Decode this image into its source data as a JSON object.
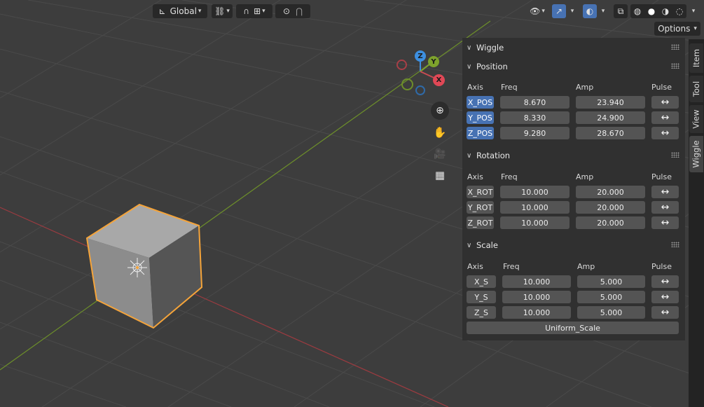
{
  "header": {
    "transform_orientation": "Global",
    "options_label": "Options"
  },
  "gizmo": {
    "x_label": "X",
    "y_label": "Y",
    "z_label": "Z"
  },
  "navigation_icons": [
    "zoom-icon",
    "hand-icon",
    "camera-icon",
    "grid-icon"
  ],
  "tabs": [
    "Item",
    "Tool",
    "View",
    "Wiggle"
  ],
  "active_tab": "Wiggle",
  "panel": {
    "title": "Wiggle",
    "position": {
      "title": "Position",
      "headers": {
        "axis": "Axis",
        "freq": "Freq",
        "amp": "Amp",
        "pulse": "Pulse"
      },
      "rows": [
        {
          "axis": "X_POS",
          "freq": "8.670",
          "amp": "23.940",
          "pulse": "↔"
        },
        {
          "axis": "Y_POS",
          "freq": "8.330",
          "amp": "24.900",
          "pulse": "↔"
        },
        {
          "axis": "Z_POS",
          "freq": "9.280",
          "amp": "28.670",
          "pulse": "↔"
        }
      ]
    },
    "rotation": {
      "title": "Rotation",
      "headers": {
        "axis": "Axis",
        "freq": "Freq",
        "amp": "Amp",
        "pulse": "Pulse"
      },
      "rows": [
        {
          "axis": "X_ROT",
          "freq": "10.000",
          "amp": "20.000",
          "pulse": "↔"
        },
        {
          "axis": "Y_ROT",
          "freq": "10.000",
          "amp": "20.000",
          "pulse": "↔"
        },
        {
          "axis": "Z_ROT",
          "freq": "10.000",
          "amp": "20.000",
          "pulse": "↔"
        }
      ]
    },
    "scale": {
      "title": "Scale",
      "headers": {
        "axis": "Axis",
        "freq": "Freq",
        "amp": "Amp",
        "pulse": "Pulse"
      },
      "rows": [
        {
          "axis": "X_S",
          "freq": "10.000",
          "amp": "5.000",
          "pulse": "↔"
        },
        {
          "axis": "Y_S",
          "freq": "10.000",
          "amp": "5.000",
          "pulse": "↔"
        },
        {
          "axis": "Z_S",
          "freq": "10.000",
          "amp": "5.000",
          "pulse": "↔"
        }
      ],
      "uniform_label": "Uniform_Scale"
    }
  },
  "colors": {
    "viewport_bg": "#3d3d3d",
    "selected_outline": "#f5a43a",
    "active_blue": "#4772b3",
    "axis_x": "#c84b53",
    "axis_y": "#7ea32c",
    "axis_z": "#3d8fe0"
  }
}
